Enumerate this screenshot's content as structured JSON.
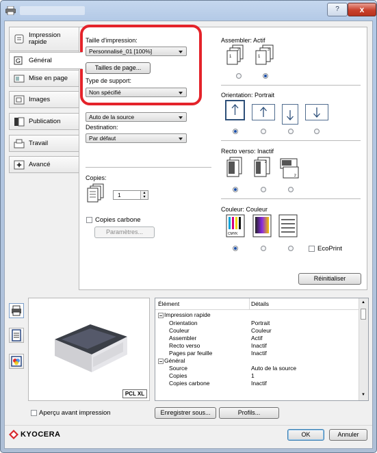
{
  "window": {
    "help_label": "?",
    "close_label": "x"
  },
  "tabs": [
    {
      "label": "Impression\nrapide",
      "icon": "quick-print-icon"
    },
    {
      "label": "Général",
      "icon": "general-icon"
    },
    {
      "label": "Mise en page",
      "icon": "layout-icon"
    },
    {
      "label": "Images",
      "icon": "images-icon"
    },
    {
      "label": "Publication",
      "icon": "publishing-icon"
    },
    {
      "label": "Travail",
      "icon": "job-icon"
    },
    {
      "label": "Avancé",
      "icon": "advanced-icon"
    }
  ],
  "general": {
    "print_size_label": "Taille d'impression:",
    "print_size_value": "Personnalisé_01 [100%]",
    "page_sizes_button": "Tailles de page...",
    "media_type_label": "Type de support:",
    "media_type_value": "Non spécifié",
    "source_value": "Auto de la source",
    "destination_label": "Destination:",
    "destination_value": "Par défaut",
    "copies_label": "Copies:",
    "copies_value": "1",
    "carbon_copies_label": "Copies carbone",
    "settings_button": "Paramètres...",
    "collate_label": "Assembler: Actif",
    "orientation_label": "Orientation: Portrait",
    "duplex_label": "Recto verso: Inactif",
    "color_label": "Couleur: Couleur",
    "ecoprint_label": "EcoPrint",
    "reset_button": "Réinitialiser"
  },
  "preview": {
    "pdl_badge": "PCL XL",
    "preview_checkbox": "Aperçu avant impression"
  },
  "summary": {
    "col_item": "Élément",
    "col_details": "Détails",
    "groups": [
      {
        "name": "Impression rapide",
        "rows": [
          {
            "item": "Orientation",
            "detail": "Portrait"
          },
          {
            "item": "Couleur",
            "detail": "Couleur"
          },
          {
            "item": "Assembler",
            "detail": "Actif"
          },
          {
            "item": "Recto verso",
            "detail": "Inactif"
          },
          {
            "item": "Pages par feuille",
            "detail": "Inactif"
          }
        ]
      },
      {
        "name": "Général",
        "rows": [
          {
            "item": "Source",
            "detail": "Auto de la source"
          },
          {
            "item": "Copies",
            "detail": "1"
          },
          {
            "item": "Copies carbone",
            "detail": "Inactif"
          }
        ]
      }
    ]
  },
  "actions": {
    "save_as_button": "Enregistrer sous...",
    "profiles_button": "Profils...",
    "ok_button": "OK",
    "cancel_button": "Annuler"
  },
  "brand": {
    "logo_text": "KYOCERA",
    "logo_color": "#d7262b"
  },
  "colors": {
    "highlight": "#e4232a",
    "selection": "#1b4fa8"
  }
}
